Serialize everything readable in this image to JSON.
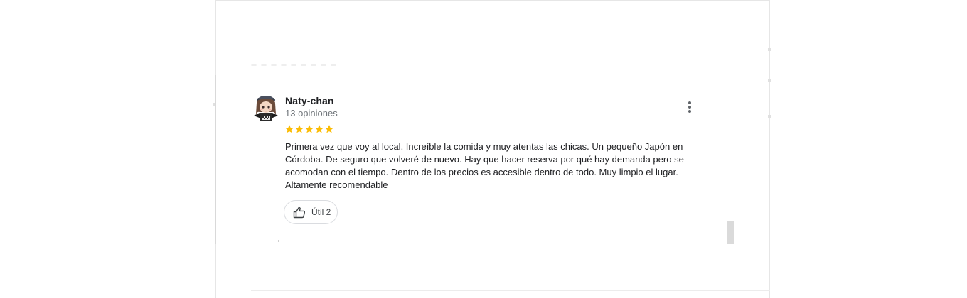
{
  "review": {
    "author_name": "Naty-chan",
    "author_meta": "13 opiniones",
    "rating": 5,
    "rating_max": 5,
    "text": "Primera vez que voy al local. Increíble la comida y muy atentas las chicas. Un pequeño Japón en Córdoba. De seguro que volveré de nuevo. Hay que hacer reserva por qué hay demanda pero se acomodan con el tiempo. Dentro de los precios es accesible dentro de todo. Muy limpio el lugar. Altamente recomendable",
    "helpful_label": "Útil 2"
  },
  "icons": {
    "avatar": "avatar-icon",
    "more": "more-vert-icon",
    "star": "star-icon",
    "thumbs_up": "thumbs-up-icon"
  },
  "colors": {
    "star": "#fbbc04",
    "text_primary": "#202124",
    "text_secondary": "#70757a",
    "border": "#dadce0"
  }
}
